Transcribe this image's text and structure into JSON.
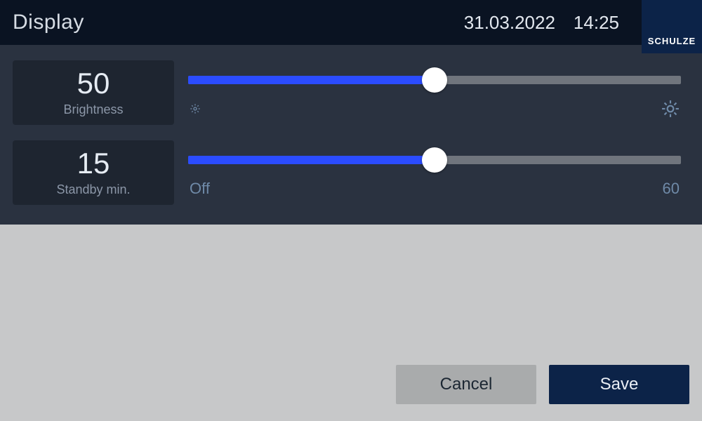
{
  "header": {
    "title": "Display",
    "date": "31.03.2022",
    "time": "14:25",
    "brand": "SCHULZE"
  },
  "brightness": {
    "value": "50",
    "label": "Brightness",
    "percent": 50
  },
  "standby": {
    "value": "15",
    "label": "Standby min.",
    "min_label": "Off",
    "max_label": "60",
    "percent": 50
  },
  "footer": {
    "cancel": "Cancel",
    "save": "Save"
  }
}
